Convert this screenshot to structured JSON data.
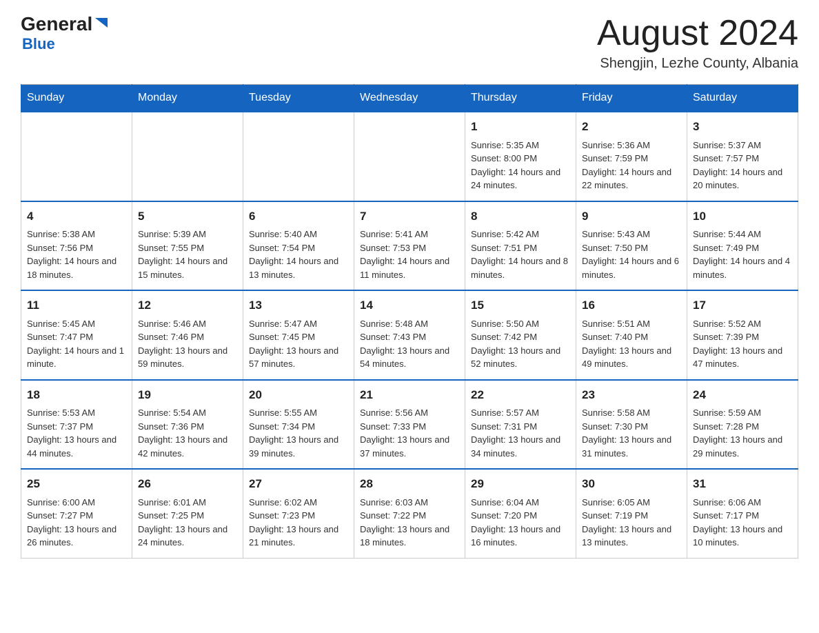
{
  "logo": {
    "general": "General",
    "triangle": "▶",
    "blue": "Blue"
  },
  "header": {
    "title": "August 2024",
    "subtitle": "Shengjin, Lezhe County, Albania"
  },
  "weekdays": [
    "Sunday",
    "Monday",
    "Tuesday",
    "Wednesday",
    "Thursday",
    "Friday",
    "Saturday"
  ],
  "weeks": [
    [
      {
        "day": "",
        "info": ""
      },
      {
        "day": "",
        "info": ""
      },
      {
        "day": "",
        "info": ""
      },
      {
        "day": "",
        "info": ""
      },
      {
        "day": "1",
        "info": "Sunrise: 5:35 AM\nSunset: 8:00 PM\nDaylight: 14 hours and 24 minutes."
      },
      {
        "day": "2",
        "info": "Sunrise: 5:36 AM\nSunset: 7:59 PM\nDaylight: 14 hours and 22 minutes."
      },
      {
        "day": "3",
        "info": "Sunrise: 5:37 AM\nSunset: 7:57 PM\nDaylight: 14 hours and 20 minutes."
      }
    ],
    [
      {
        "day": "4",
        "info": "Sunrise: 5:38 AM\nSunset: 7:56 PM\nDaylight: 14 hours and 18 minutes."
      },
      {
        "day": "5",
        "info": "Sunrise: 5:39 AM\nSunset: 7:55 PM\nDaylight: 14 hours and 15 minutes."
      },
      {
        "day": "6",
        "info": "Sunrise: 5:40 AM\nSunset: 7:54 PM\nDaylight: 14 hours and 13 minutes."
      },
      {
        "day": "7",
        "info": "Sunrise: 5:41 AM\nSunset: 7:53 PM\nDaylight: 14 hours and 11 minutes."
      },
      {
        "day": "8",
        "info": "Sunrise: 5:42 AM\nSunset: 7:51 PM\nDaylight: 14 hours and 8 minutes."
      },
      {
        "day": "9",
        "info": "Sunrise: 5:43 AM\nSunset: 7:50 PM\nDaylight: 14 hours and 6 minutes."
      },
      {
        "day": "10",
        "info": "Sunrise: 5:44 AM\nSunset: 7:49 PM\nDaylight: 14 hours and 4 minutes."
      }
    ],
    [
      {
        "day": "11",
        "info": "Sunrise: 5:45 AM\nSunset: 7:47 PM\nDaylight: 14 hours and 1 minute."
      },
      {
        "day": "12",
        "info": "Sunrise: 5:46 AM\nSunset: 7:46 PM\nDaylight: 13 hours and 59 minutes."
      },
      {
        "day": "13",
        "info": "Sunrise: 5:47 AM\nSunset: 7:45 PM\nDaylight: 13 hours and 57 minutes."
      },
      {
        "day": "14",
        "info": "Sunrise: 5:48 AM\nSunset: 7:43 PM\nDaylight: 13 hours and 54 minutes."
      },
      {
        "day": "15",
        "info": "Sunrise: 5:50 AM\nSunset: 7:42 PM\nDaylight: 13 hours and 52 minutes."
      },
      {
        "day": "16",
        "info": "Sunrise: 5:51 AM\nSunset: 7:40 PM\nDaylight: 13 hours and 49 minutes."
      },
      {
        "day": "17",
        "info": "Sunrise: 5:52 AM\nSunset: 7:39 PM\nDaylight: 13 hours and 47 minutes."
      }
    ],
    [
      {
        "day": "18",
        "info": "Sunrise: 5:53 AM\nSunset: 7:37 PM\nDaylight: 13 hours and 44 minutes."
      },
      {
        "day": "19",
        "info": "Sunrise: 5:54 AM\nSunset: 7:36 PM\nDaylight: 13 hours and 42 minutes."
      },
      {
        "day": "20",
        "info": "Sunrise: 5:55 AM\nSunset: 7:34 PM\nDaylight: 13 hours and 39 minutes."
      },
      {
        "day": "21",
        "info": "Sunrise: 5:56 AM\nSunset: 7:33 PM\nDaylight: 13 hours and 37 minutes."
      },
      {
        "day": "22",
        "info": "Sunrise: 5:57 AM\nSunset: 7:31 PM\nDaylight: 13 hours and 34 minutes."
      },
      {
        "day": "23",
        "info": "Sunrise: 5:58 AM\nSunset: 7:30 PM\nDaylight: 13 hours and 31 minutes."
      },
      {
        "day": "24",
        "info": "Sunrise: 5:59 AM\nSunset: 7:28 PM\nDaylight: 13 hours and 29 minutes."
      }
    ],
    [
      {
        "day": "25",
        "info": "Sunrise: 6:00 AM\nSunset: 7:27 PM\nDaylight: 13 hours and 26 minutes."
      },
      {
        "day": "26",
        "info": "Sunrise: 6:01 AM\nSunset: 7:25 PM\nDaylight: 13 hours and 24 minutes."
      },
      {
        "day": "27",
        "info": "Sunrise: 6:02 AM\nSunset: 7:23 PM\nDaylight: 13 hours and 21 minutes."
      },
      {
        "day": "28",
        "info": "Sunrise: 6:03 AM\nSunset: 7:22 PM\nDaylight: 13 hours and 18 minutes."
      },
      {
        "day": "29",
        "info": "Sunrise: 6:04 AM\nSunset: 7:20 PM\nDaylight: 13 hours and 16 minutes."
      },
      {
        "day": "30",
        "info": "Sunrise: 6:05 AM\nSunset: 7:19 PM\nDaylight: 13 hours and 13 minutes."
      },
      {
        "day": "31",
        "info": "Sunrise: 6:06 AM\nSunset: 7:17 PM\nDaylight: 13 hours and 10 minutes."
      }
    ]
  ]
}
